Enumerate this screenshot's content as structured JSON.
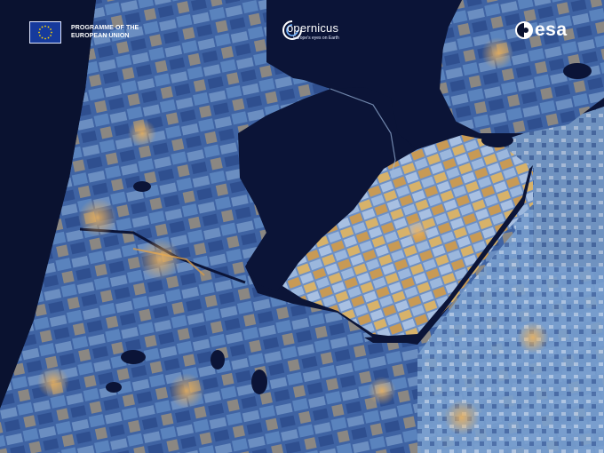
{
  "image": {
    "subject": "Sentinel satellite view of the IJsselmeer / Markermeer area and Flevoland, Netherlands",
    "palette": {
      "water_dark": "#0b1437",
      "land_blue": "#4f74b0",
      "land_light": "#8fb0d8",
      "field_yellow": "#d8b060",
      "field_orange": "#e08a3a"
    }
  },
  "logos": {
    "eu": {
      "icon": "eu-flag-icon",
      "line1": "PROGRAMME OF THE",
      "line2": "EUROPEAN UNION",
      "flag_color": "#163a9c",
      "star_color": "#ffd700"
    },
    "copernicus": {
      "name": "opernicus",
      "tagline": "Europe's eyes on Earth",
      "icon": "copernicus-swirl-icon"
    },
    "esa": {
      "name": "esa",
      "icon": "esa-logo-icon"
    }
  }
}
